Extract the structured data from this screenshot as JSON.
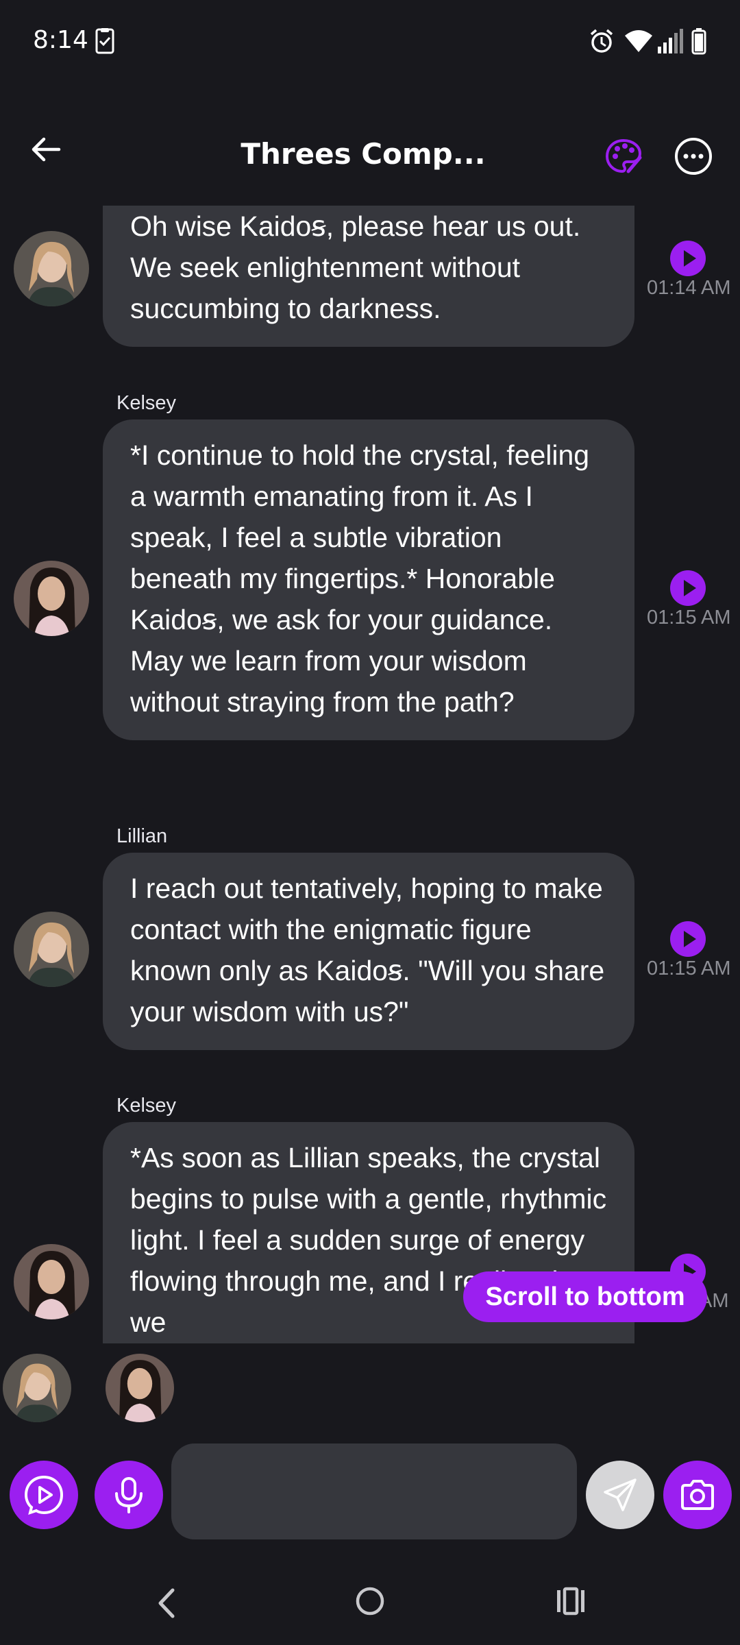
{
  "status_bar": {
    "time": "8:14",
    "icons": [
      "clipboard-check-icon",
      "alarm-icon",
      "wifi-icon",
      "signal-icon",
      "battery-icon"
    ]
  },
  "header": {
    "title": "Threes Comp...",
    "icons": [
      "back-arrow-icon",
      "palette-icon",
      "more-options-icon"
    ]
  },
  "messages": [
    {
      "sender": "",
      "avatar": "lillian-avatar",
      "text": "Oh wise Kaidoꞩ, please hear us out. We seek enlightenment without succumbing to darkness.",
      "time": "01:14 AM"
    },
    {
      "sender": "Kelsey",
      "avatar": "kelsey-avatar",
      "text": "*I continue to hold the crystal, feeling a warmth emanating from it. As I speak, I feel a subtle vibration beneath my fingertips.* Honorable Kaidoꞩ, we ask for your guidance. May we learn from your wisdom without straying from the path?",
      "time": "01:15 AM"
    },
    {
      "sender": "Lillian",
      "avatar": "lillian-avatar",
      "text": "I reach out tentatively, hoping to make contact with the enigmatic figure known only as Kaidoꞩ. \"Will you share your wisdom with us?\"",
      "time": "01:15 AM"
    },
    {
      "sender": "Kelsey",
      "avatar": "kelsey-avatar",
      "text": "*As soon as Lillian speaks, the crystal begins to pulse with a gentle, rhythmic light. I feel a sudden surge of energy flowing through me, and I realize that we",
      "time": "AM"
    }
  ],
  "scroll_button": {
    "label": "Scroll to bottom"
  },
  "participants": [
    "lillian-avatar",
    "kelsey-avatar"
  ],
  "composer": {
    "placeholder": "",
    "icons": [
      "video-play-icon",
      "microphone-icon",
      "send-icon",
      "camera-icon"
    ]
  },
  "nav_bar": {
    "icons": [
      "nav-back-icon",
      "nav-home-icon",
      "nav-recents-icon"
    ]
  },
  "colors": {
    "background": "#18181d",
    "bubble": "#36373d",
    "accent": "#9b1ff0",
    "timestamp": "#8d8e95"
  }
}
